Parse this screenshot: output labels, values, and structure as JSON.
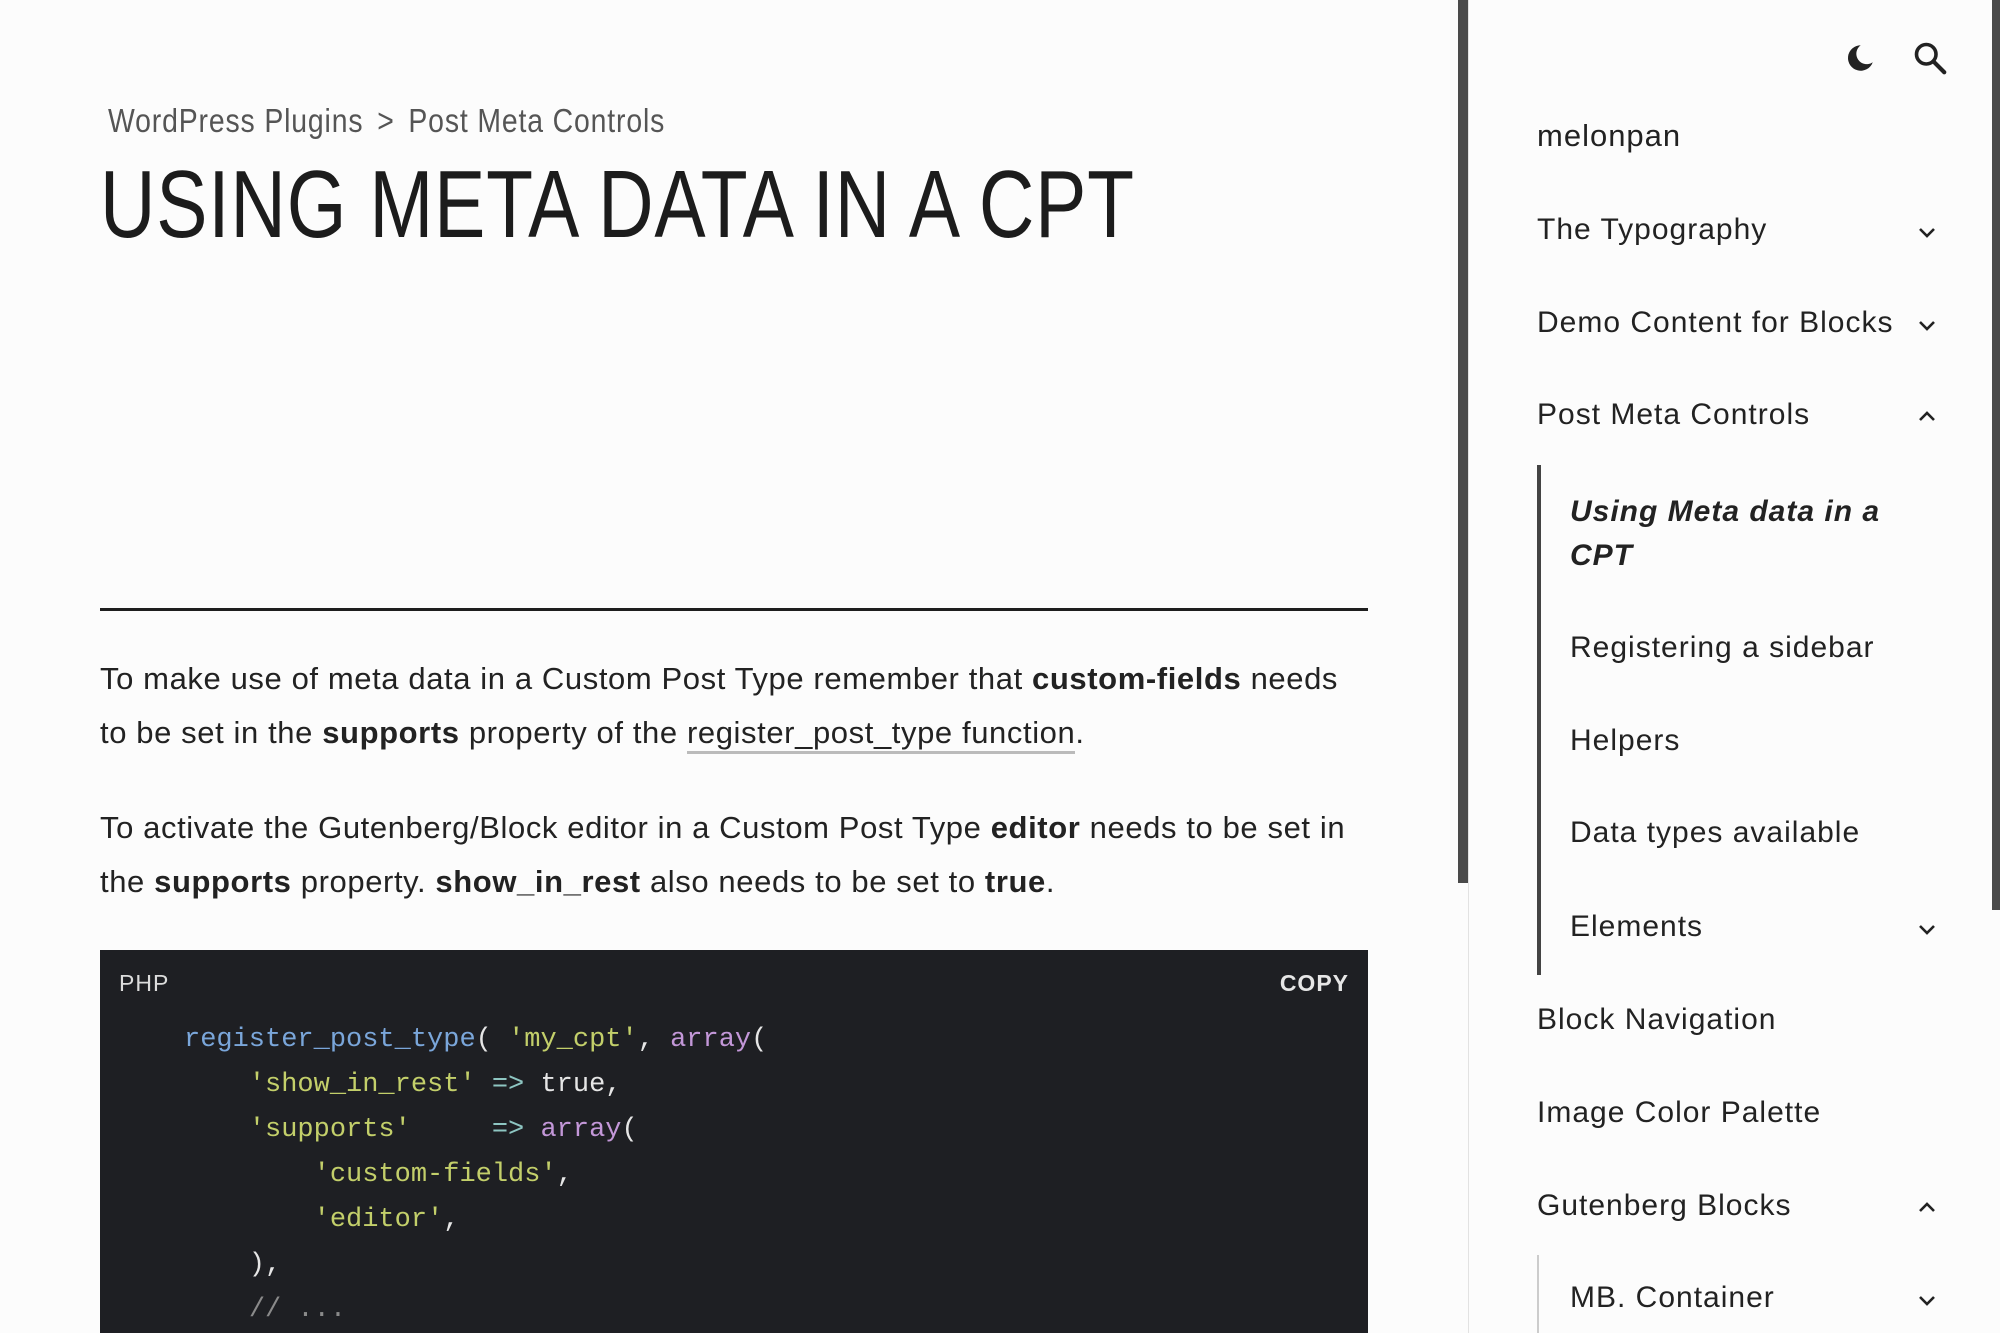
{
  "breadcrumb": {
    "parent": "WordPress Plugins",
    "separator": ">",
    "current": "Post Meta Controls"
  },
  "page": {
    "title": "USING META DATA IN A CPT"
  },
  "content": {
    "p1": {
      "t1": "To make use of meta data in a Custom Post Type remember that ",
      "b1": "custom-fields",
      "t2": " needs to be set in the ",
      "b2": "supports",
      "t3": " property of the ",
      "link": "register_post_type function",
      "t4": "."
    },
    "p2": {
      "t1": "To activate the Gutenberg/Block editor in a Custom Post Type ",
      "b1": "editor",
      "t2": " needs to be set in the ",
      "b2": "supports",
      "t3": " property. ",
      "b3": "show_in_rest",
      "t4": " also needs to be set to ",
      "b4": "true",
      "t5": "."
    }
  },
  "code_block": {
    "language": "PHP",
    "copy_label": "COPY",
    "lines": [
      [
        [
          "fn",
          "register_post_type"
        ],
        [
          "plain",
          "( "
        ],
        [
          "str",
          "'my_cpt'"
        ],
        [
          "plain",
          ", "
        ],
        [
          "kw",
          "array"
        ],
        [
          "plain",
          "("
        ]
      ],
      [
        [
          "plain",
          "    "
        ],
        [
          "str",
          "'show_in_rest'"
        ],
        [
          "plain",
          " "
        ],
        [
          "op",
          "=>"
        ],
        [
          "plain",
          " true,"
        ]
      ],
      [
        [
          "plain",
          "    "
        ],
        [
          "str",
          "'supports'"
        ],
        [
          "plain",
          "     "
        ],
        [
          "op",
          "=>"
        ],
        [
          "plain",
          " "
        ],
        [
          "kw",
          "array"
        ],
        [
          "plain",
          "("
        ]
      ],
      [
        [
          "plain",
          "        "
        ],
        [
          "str",
          "'custom-fields'"
        ],
        [
          "plain",
          ","
        ]
      ],
      [
        [
          "plain",
          "        "
        ],
        [
          "str",
          "'editor'"
        ],
        [
          "plain",
          ","
        ]
      ],
      [
        [
          "plain",
          "    ),"
        ]
      ],
      [
        [
          "plain",
          "    "
        ],
        [
          "com",
          "// ..."
        ]
      ]
    ]
  },
  "sidebar": {
    "site_name": "melonpan",
    "icons": [
      "moon-icon",
      "search-icon"
    ],
    "nav": [
      {
        "label": "The Typography",
        "chevron": "down"
      },
      {
        "label": "Demo Content for Blocks",
        "chevron": "down"
      },
      {
        "label": "Post Meta Controls",
        "chevron": "up"
      }
    ],
    "sub_nav": [
      {
        "label": "Using Meta data in a CPT",
        "active": true
      },
      {
        "label": "Registering a sidebar"
      },
      {
        "label": "Helpers"
      },
      {
        "label": "Data types available"
      },
      {
        "label": "Elements",
        "chevron": "down"
      }
    ],
    "nav_after": [
      {
        "label": "Block Navigation"
      },
      {
        "label": "Image Color Palette"
      },
      {
        "label": "Gutenberg Blocks",
        "chevron": "up"
      }
    ],
    "sub_nav_2": [
      {
        "label": "MB. Container",
        "chevron": "down"
      }
    ]
  },
  "colors": {
    "background": "#fcfcfc",
    "code_background": "#1e1f23",
    "code_function": "#7aa6da",
    "code_string": "#c3cf6a",
    "code_keyword": "#c397d8",
    "code_operator": "#8ec6c2",
    "code_comment": "#8a8a8a"
  }
}
